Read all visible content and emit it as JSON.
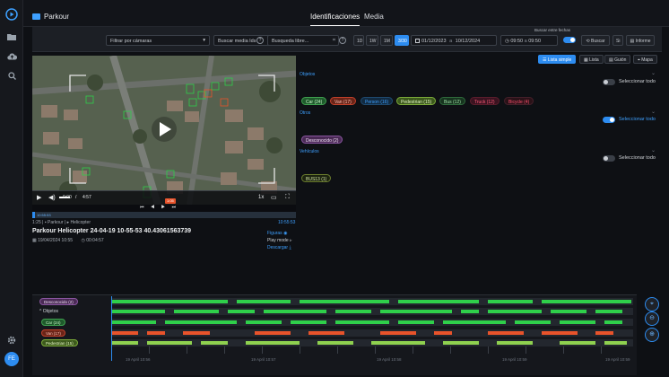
{
  "app": {
    "breadcrumb": "Parkour",
    "tabs": [
      {
        "label": "Identificaciones",
        "active": true
      },
      {
        "label": "Media",
        "active": false
      }
    ],
    "user_initials": "FE"
  },
  "sidebar": {
    "items": [
      {
        "icon": "play-circle-icon"
      },
      {
        "icon": "folder-icon"
      },
      {
        "icon": "upload-cloud-icon"
      },
      {
        "icon": "search-icon"
      }
    ],
    "bottom": [
      {
        "icon": "gear-icon"
      }
    ]
  },
  "filters": {
    "camera_filter": "Filtrar por cámaras",
    "media_search": "Buscar media Ids",
    "free_search": "Busqueda libre...",
    "ranges": [
      "1D",
      "1W",
      "1M",
      "3/30"
    ],
    "date_from": "01/12/2023",
    "date_sep": "a",
    "date_to": "10/12/2024",
    "time_from": "09:50",
    "time_to": "09:50",
    "between_dates_label": "Buscar entre fechas",
    "search_button": "Buscar",
    "si_button": "Si",
    "report_button": "Informe"
  },
  "video": {
    "current_time": "0:00",
    "separator": "/",
    "duration": "4:57",
    "speed": "1x",
    "frame_label": "1:05",
    "timestamp_badge": "10:55:53"
  },
  "media": {
    "crumb_index": "1:25",
    "crumb_project": "Parkour",
    "crumb_camera": "Helicopter",
    "timestamp": "10:55:53",
    "title": "Parkour Helicopter 24-04-19 10-55-53 40.43061563739",
    "date": "19/04/2024 10:55",
    "duration": "00:04:57",
    "links": [
      {
        "label": "Figuras",
        "icon": "eye-icon"
      },
      {
        "label": "Play mode",
        "icon": "play-icon"
      },
      {
        "label": "Descargar",
        "icon": "download-icon"
      }
    ]
  },
  "views": [
    {
      "label": "Lista simple",
      "active": true
    },
    {
      "label": "Lista",
      "active": false
    },
    {
      "label": "Guión",
      "active": false
    },
    {
      "label": "Mapa",
      "active": false
    }
  ],
  "sections": [
    {
      "title": "Objetos",
      "select_all": "Seleccionar todo",
      "toggle_on": false,
      "chips": [
        {
          "label": "Car (24)",
          "bg": "#1f5a2c",
          "fg": "#c8f5c8",
          "border": "#3fa14f"
        },
        {
          "label": "Van (17)",
          "bg": "#6a2418",
          "fg": "#ffc4b8",
          "border": "#c2412a"
        },
        {
          "label": "Person (16)",
          "bg": "#122a40",
          "fg": "#3ea0ff",
          "border": "#1e4a70"
        },
        {
          "label": "Pedestrian (15)",
          "bg": "#3d5a1d",
          "fg": "#e5f7c4",
          "border": "#7cab3a"
        },
        {
          "label": "Bus (12)",
          "bg": "#17341f",
          "fg": "#9fe0a8",
          "border": "#2f6b3c"
        },
        {
          "label": "Truck (12)",
          "bg": "#3a1320",
          "fg": "#ff5b7a",
          "border": "#5b1d2c"
        },
        {
          "label": "Bicycle (4)",
          "bg": "#2a1218",
          "fg": "#ff4f6e",
          "border": "#44202a"
        }
      ]
    },
    {
      "title": "Otros",
      "select_all": "Seleccionar todo",
      "toggle_on": true,
      "chips": [
        {
          "label": "Desconocido (2)",
          "bg": "#4a2a55",
          "fg": "#f2e2f8",
          "border": "#8a56a0"
        }
      ]
    },
    {
      "title": "Vehículos",
      "select_all": "Seleccionar todo",
      "toggle_on": false,
      "chips": [
        {
          "label": "BUS13 (1)",
          "bg": "#1d2410",
          "fg": "#d4e7a8",
          "border": "#6b7d2e"
        }
      ]
    }
  ],
  "timeline": {
    "rows": [
      {
        "label": "Desconocido (2)",
        "bg": "#4a2a55",
        "fg": "#f2e2f8",
        "color": "#8a56a0"
      },
      {
        "label": "Objetos",
        "group": true
      },
      {
        "label": "Car (24)",
        "bg": "#1f5a2c",
        "fg": "#c8f5c8",
        "color": "#2fcf4a"
      },
      {
        "label": "Van (17)",
        "bg": "#6a2418",
        "fg": "#ffc4b8",
        "color": "#e8532b"
      },
      {
        "label": "Pedestrian (15)",
        "bg": "#3d5a1d",
        "fg": "#e5f7c4",
        "color": "#8fd14f"
      }
    ],
    "time_labels": [
      "19 April 10:56",
      "19 April 10:57",
      "19 April 10:58",
      "19 April 10:59",
      "19 April 10:59"
    ]
  }
}
